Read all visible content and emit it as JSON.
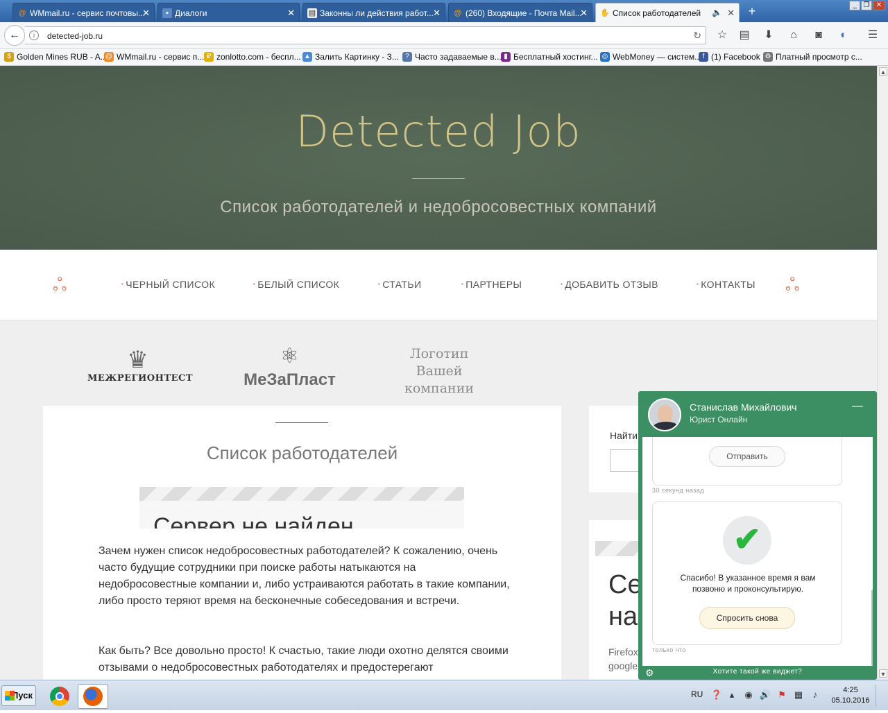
{
  "browser": {
    "tabs": [
      {
        "label": "WMmail.ru - сервис почтовы...",
        "icon": "wmmail-icon",
        "active": false
      },
      {
        "label": "Диалоги",
        "icon": "dialog-icon",
        "active": false
      },
      {
        "label": "Законны ли действия работ...",
        "icon": "document-icon",
        "active": false
      },
      {
        "label": "(260) Входящие - Почта Mail...",
        "icon": "mail-icon",
        "active": false
      },
      {
        "label": "Список работодателей",
        "icon": "hand-icon",
        "active": true
      }
    ],
    "url": "detected-job.ru",
    "bookmarks": [
      {
        "label": "Golden Mines RUB - A...",
        "icon": "coin-icon",
        "color": "#d4a017"
      },
      {
        "label": "WMmail.ru - сервис п...",
        "icon": "wmmail-icon",
        "color": "#f08a24"
      },
      {
        "label": "zonlotto.com - беспл...",
        "icon": "lotto-icon",
        "color": "#e2b007"
      },
      {
        "label": "Залить Картинку - З...",
        "icon": "image-icon",
        "color": "#4a8ad4"
      },
      {
        "label": "Часто задаваемые в...",
        "icon": "faq-icon",
        "color": "#5577aa"
      },
      {
        "label": "Бесплатный хостинг...",
        "icon": "hosting-icon",
        "color": "#7a2a8a"
      },
      {
        "label": "WebMoney — систем...",
        "icon": "globe-icon",
        "color": "#2a72c4"
      },
      {
        "label": "(1) Facebook",
        "icon": "facebook-icon",
        "color": "#3b5998"
      },
      {
        "label": "Платный просмотр с...",
        "icon": "gear-icon",
        "color": "#777777"
      }
    ]
  },
  "site": {
    "title": "Detected Job",
    "subtitle": "Список работодателей и недобросовестных компаний",
    "menu": [
      "ЧЕРНЫЙ СПИСОК",
      "БЕЛЫЙ СПИСОК",
      "СТАТЬИ",
      "ПАРТНЕРЫ",
      "ДОБАВИТЬ ОТЗЫВ",
      "КОНТАКТЫ"
    ],
    "partners": {
      "logo1": "МЕЖРЕГИОНТЕСТ",
      "logo2": "МеЗаПласт",
      "logo3": [
        "Логотип",
        "Вашей",
        "компании"
      ]
    },
    "main": {
      "title": "Список работодателей",
      "error_title": "Сервер не найден",
      "paragraph1": "Зачем нужен список недобросовестных работодателей? К сожалению, очень часто будущие сотрудники при поиске работы натыкаются на недобросовестные компании и, либо устраиваются работать в такие компании, либо просто теряют время на бесконечные собеседования и встречи.",
      "paragraph2": "Как быть? Все довольно просто! К счастью, такие люди охотно делятся своими отзывами о недобросовестных работодателях и предостерегают"
    },
    "sidebar": {
      "search_label": "Найти",
      "error_title_part": "Се\nна",
      "error_text_part": "Firefox\ngoogle"
    }
  },
  "chat": {
    "name": "Станислав Михайлович",
    "role": "Юрист Онлайн",
    "send_label": "Отправить",
    "time1": "30 секунд назад",
    "thanks": "Спасибо! В указанное время я вам позвоню и проконсультирую.",
    "ask_label": "Спросить снова",
    "time2": "только что",
    "promo": "Хотите такой же виджет?",
    "accent": "#3c8f63"
  },
  "taskbar": {
    "start": "Пуск",
    "lang": "RU",
    "time": "4:25",
    "date": "05.10.2016"
  }
}
